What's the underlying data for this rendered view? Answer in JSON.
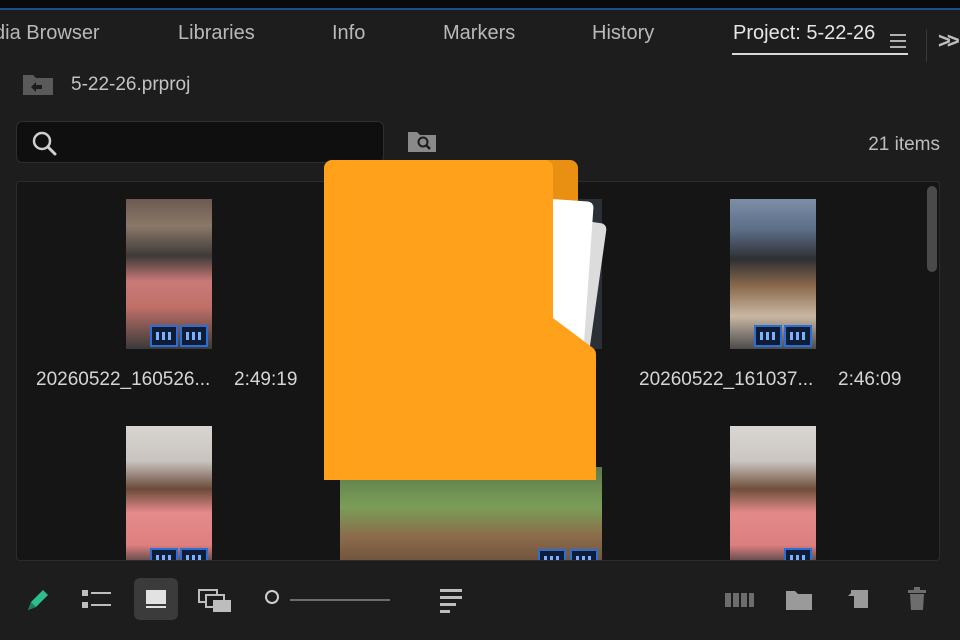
{
  "tabs": [
    {
      "label": "dia Browser"
    },
    {
      "label": "Libraries"
    },
    {
      "label": "Info"
    },
    {
      "label": "Markers"
    },
    {
      "label": "History"
    },
    {
      "label": "Project: 5-22-26"
    }
  ],
  "project": {
    "file_name": "5-22-26.prproj"
  },
  "search": {
    "placeholder": ""
  },
  "items_count": "21 items",
  "clips": [
    {
      "name": "20260522_160526...",
      "duration": "2:49:19"
    },
    {
      "name": "20260522_161037...",
      "duration": "2:46:09"
    }
  ],
  "colors": {
    "folder": "#FFA11A",
    "folder_dark": "#E98F12",
    "accent": "#2B6FD6",
    "pen": "#2DBE8C"
  },
  "icons": [
    "project-folder-icon",
    "search-icon",
    "find-bin-icon",
    "panel-menu-icon",
    "overflow-icon",
    "pen-icon",
    "list-view-icon",
    "icon-view-icon",
    "freeform-view-icon",
    "zoom-slider",
    "sort-icon",
    "automate-to-sequence-icon",
    "new-bin-icon",
    "new-item-icon",
    "trash-icon"
  ]
}
